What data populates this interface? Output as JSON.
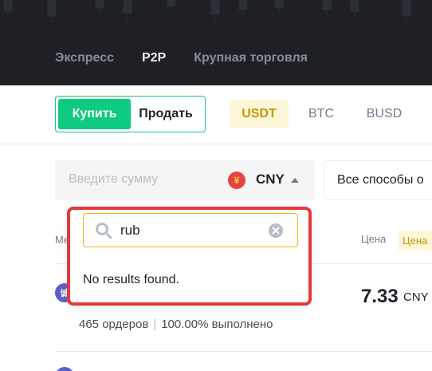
{
  "header": {
    "nav": [
      {
        "label": "Экспресс",
        "active": false
      },
      {
        "label": "P2P",
        "active": true
      },
      {
        "label": "Крупная торговля",
        "active": false
      }
    ]
  },
  "trade_toggle": {
    "buy_label": "Купить",
    "sell_label": "Продать",
    "selected": "buy"
  },
  "assets": [
    {
      "label": "USDT",
      "active": true
    },
    {
      "label": "BTC",
      "active": false
    },
    {
      "label": "BUSD",
      "active": false
    }
  ],
  "amount": {
    "placeholder": "Введите сумму",
    "currency_symbol": "¥",
    "currency": "CNY"
  },
  "payment": {
    "label": "Все способы о"
  },
  "currency_dropdown": {
    "search_value": "rub",
    "no_results": "No results found."
  },
  "table": {
    "left_header": "Ме",
    "price_header": "Цена",
    "price_chip": "Цена",
    "rows": [
      {
        "avatar": "诚",
        "orders": "465 ордеров",
        "completion": "100.00% выполнено",
        "price": "7.33",
        "currency": "CNY"
      }
    ]
  },
  "colors": {
    "header_bg": "#1e2026",
    "buy_green": "#0ecb81",
    "accent_yellow": "#f0b90b",
    "highlight_red": "#e03a3a"
  }
}
